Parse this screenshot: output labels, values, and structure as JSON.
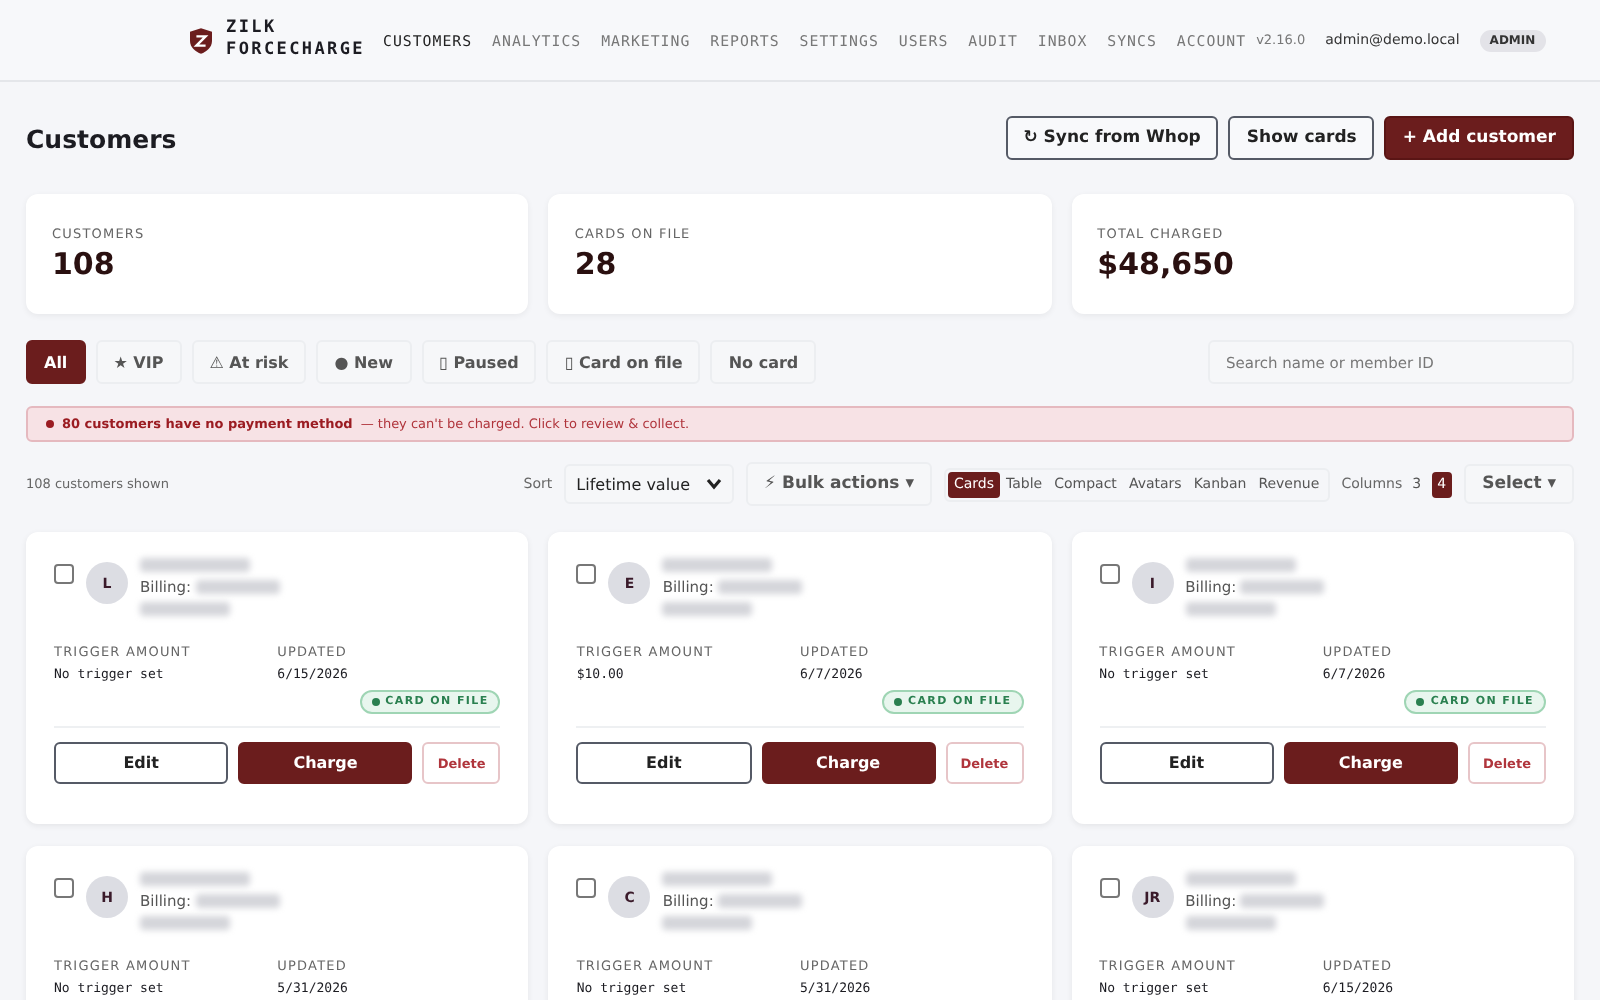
{
  "brand": {
    "line_1": "ZILK",
    "line_2": "FORCECHARGE"
  },
  "nav": [
    {
      "label": "CUSTOMERS",
      "selected": true
    },
    {
      "label": "ANALYTICS",
      "selected": false
    },
    {
      "label": "MARKETING",
      "selected": false
    },
    {
      "label": "REPORTS",
      "selected": false
    },
    {
      "label": "SETTINGS",
      "selected": false
    },
    {
      "label": "USERS",
      "selected": false
    },
    {
      "label": "AUDIT",
      "selected": false
    },
    {
      "label": "INBOX",
      "selected": false
    },
    {
      "label": "SYNCS",
      "selected": false
    },
    {
      "label": "ACCOUNT",
      "selected": false
    }
  ],
  "version": "v2.16.0",
  "user_email": "admin@demo.local",
  "role_badge": "ADMIN",
  "page_title": "Customers",
  "header_buttons": [
    {
      "label": "↻ Sync from Whop",
      "kind": "outline"
    },
    {
      "label": "Show cards",
      "kind": "outline"
    },
    {
      "label": "+ Add customer",
      "kind": "primary"
    }
  ],
  "stats": [
    {
      "label": "CUSTOMERS",
      "value": "108"
    },
    {
      "label": "CARDS ON FILE",
      "value": "28"
    },
    {
      "label": "TOTAL CHARGED",
      "value": "$48,650"
    }
  ],
  "filters": [
    {
      "label": "All",
      "selected": true
    },
    {
      "label": "★ VIP",
      "selected": false
    },
    {
      "label": "⚠ At risk",
      "selected": false
    },
    {
      "label": "● New",
      "selected": false
    },
    {
      "label": "▯ Paused",
      "selected": false
    },
    {
      "label": "▯ Card on file",
      "selected": false
    },
    {
      "label": "No card",
      "selected": false
    }
  ],
  "search": {
    "placeholder": "Search name or member ID"
  },
  "alert": {
    "bold": "80 customers have no payment method",
    "rest": "— they can't be charged. Click to review & collect."
  },
  "shown_count": "108 customers shown",
  "sort": {
    "label": "Sort",
    "value": "Lifetime value"
  },
  "bulk_actions": "⚡ Bulk actions ▾",
  "views": [
    {
      "label": "Cards",
      "selected": true
    },
    {
      "label": "Table",
      "selected": false
    },
    {
      "label": "Compact",
      "selected": false
    },
    {
      "label": "Avatars",
      "selected": false
    },
    {
      "label": "Kanban",
      "selected": false
    },
    {
      "label": "Revenue",
      "selected": false
    }
  ],
  "columns": {
    "label": "Columns",
    "options": [
      {
        "label": "3",
        "selected": false
      },
      {
        "label": "4",
        "selected": true
      }
    ]
  },
  "select_button": "Select ▾",
  "customers": [
    {
      "initials": "L",
      "checked": false,
      "billing_label": "Billing:",
      "trigger_label": "TRIGGER AMOUNT",
      "trigger": "No trigger set",
      "updated_label": "UPDATED",
      "updated": "6/15/2026",
      "badge": "CARD ON FILE",
      "actions": [
        "Edit",
        "Charge",
        "Delete"
      ]
    },
    {
      "initials": "E",
      "checked": false,
      "billing_label": "Billing:",
      "trigger_label": "TRIGGER AMOUNT",
      "trigger": "$10.00",
      "updated_label": "UPDATED",
      "updated": "6/7/2026",
      "badge": "CARD ON FILE",
      "actions": [
        "Edit",
        "Charge",
        "Delete"
      ]
    },
    {
      "initials": "I",
      "checked": false,
      "billing_label": "Billing:",
      "trigger_label": "TRIGGER AMOUNT",
      "trigger": "No trigger set",
      "updated_label": "UPDATED",
      "updated": "6/7/2026",
      "badge": "CARD ON FILE",
      "actions": [
        "Edit",
        "Charge",
        "Delete"
      ]
    },
    {
      "initials": "H",
      "checked": false,
      "billing_label": "Billing:",
      "trigger_label": "TRIGGER AMOUNT",
      "trigger": "No trigger set",
      "updated_label": "UPDATED",
      "updated": "5/31/2026"
    },
    {
      "initials": "C",
      "checked": false,
      "billing_label": "Billing:",
      "trigger_label": "TRIGGER AMOUNT",
      "trigger": "No trigger set",
      "updated_label": "UPDATED",
      "updated": "5/31/2026"
    },
    {
      "initials": "JR",
      "checked": false,
      "billing_label": "Billing:",
      "trigger_label": "TRIGGER AMOUNT",
      "trigger": "No trigger set",
      "updated_label": "UPDATED",
      "updated": "6/15/2026"
    }
  ]
}
